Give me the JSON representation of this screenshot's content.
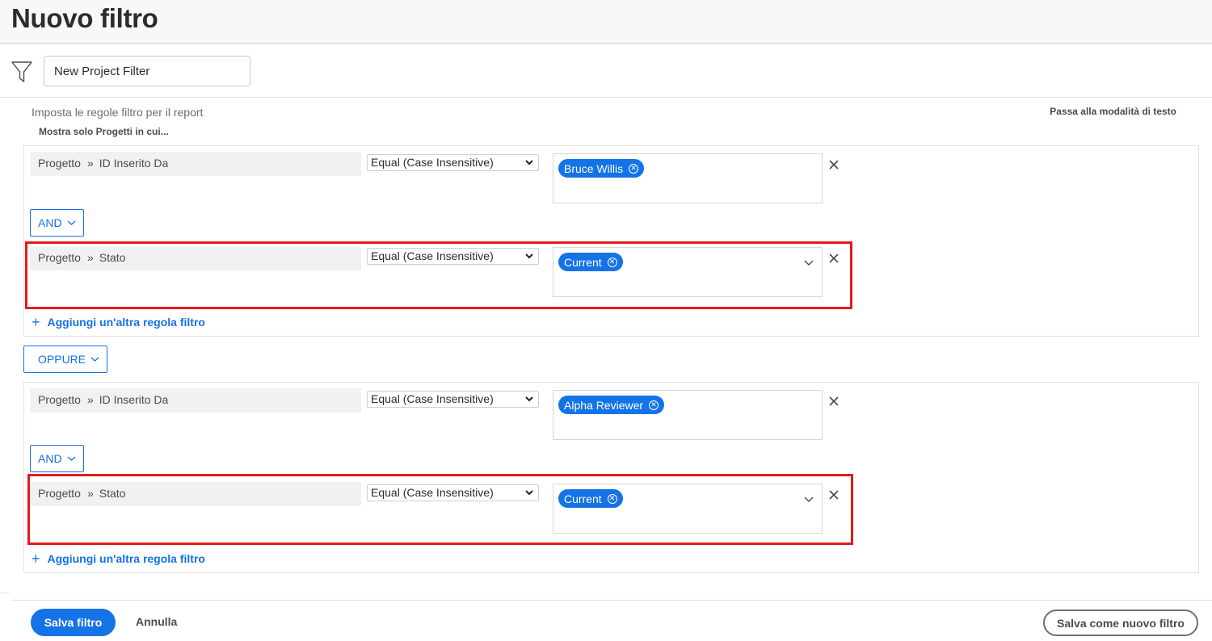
{
  "header": {
    "title": "Nuovo filtro"
  },
  "filter_name": {
    "value": "New Project Filter"
  },
  "subtitle": "Imposta le regole filtro per il report",
  "subhint": "Mostra solo Progetti in cui...",
  "text_mode_link": "Passa alla modalità di testo",
  "groups": [
    {
      "rules": [
        {
          "object": "Progetto",
          "field": "ID Inserito Da",
          "operator": "Equal (Case Insensitive)",
          "value": "Bruce Willis",
          "has_dropdown": false
        },
        {
          "object": "Progetto",
          "field": "Stato",
          "operator": "Equal (Case Insensitive)",
          "value": "Current",
          "has_dropdown": true
        }
      ],
      "conjunction": "AND",
      "add_rule": "Aggiungi un'altra regola filtro"
    },
    {
      "rules": [
        {
          "object": "Progetto",
          "field": "ID Inserito Da",
          "operator": "Equal (Case Insensitive)",
          "value": "Alpha Reviewer",
          "has_dropdown": false
        },
        {
          "object": "Progetto",
          "field": "Stato",
          "operator": "Equal (Case Insensitive)",
          "value": "Current",
          "has_dropdown": true
        }
      ],
      "conjunction": "AND",
      "add_rule": "Aggiungi un'altra regola filtro"
    }
  ],
  "group_conjunction": "OPPURE",
  "footer": {
    "save": "Salva filtro",
    "cancel": "Annulla",
    "save_new": "Salva come nuovo filtro"
  },
  "colors": {
    "accent": "#1473e6",
    "highlight": "#e31b1b"
  },
  "icons": {
    "filter": "funnel-icon",
    "remove": "close-icon",
    "expand": "chevron-down-icon",
    "breadcrumb": "double-chevron-right-icon",
    "tag_remove": "circle-x-icon",
    "add": "plus-icon"
  }
}
